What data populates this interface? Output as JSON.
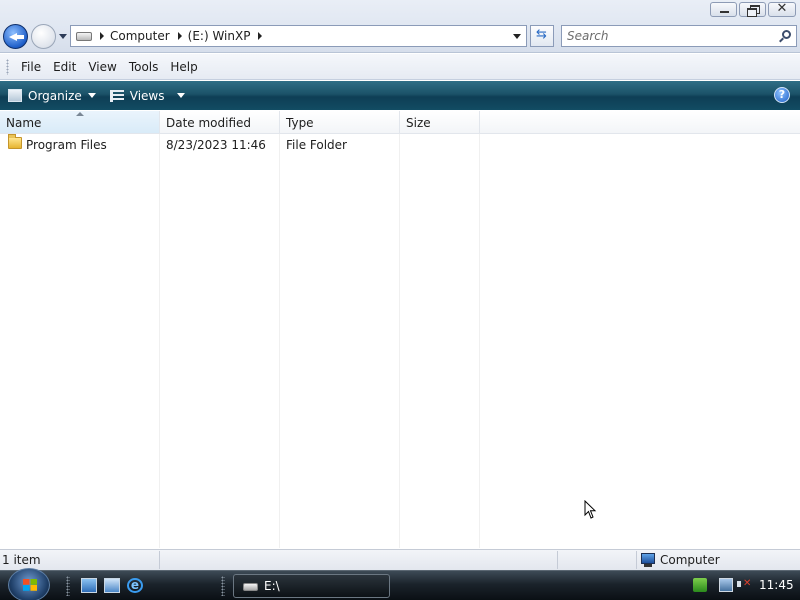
{
  "window": {
    "address": {
      "crumbs": [
        "Computer",
        "(E:) WinXP"
      ]
    },
    "search": {
      "placeholder": "Search"
    },
    "menu": [
      "File",
      "Edit",
      "View",
      "Tools",
      "Help"
    ],
    "commands": {
      "organize": "Organize",
      "views": "Views"
    },
    "columns": [
      "Name",
      "Date modified",
      "Type",
      "Size"
    ],
    "files": [
      {
        "name": "Program Files",
        "date_modified": "8/23/2023 11:46",
        "type": "File Folder",
        "size": "",
        "icon": "folder-icon"
      }
    ],
    "status": {
      "count": "1 item",
      "location": "Computer"
    }
  },
  "taskbar": {
    "task_label": "E:\\",
    "clock": "11:45"
  },
  "colors": {
    "command_bar": "#1b5268",
    "taskbar": "#1b232b",
    "back_button": "#1f5fc9"
  }
}
